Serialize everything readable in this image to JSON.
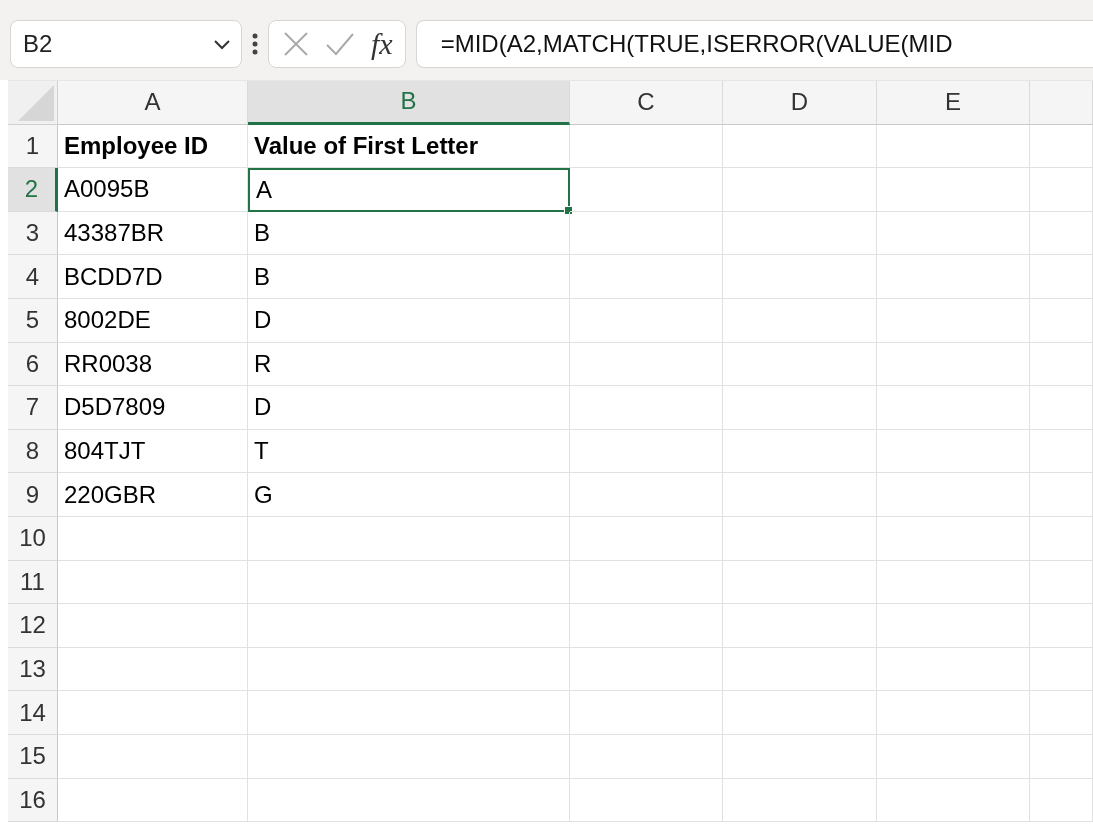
{
  "formula_bar": {
    "name_box": "B2",
    "function_button": "fx",
    "formula": "=MID(A2,MATCH(TRUE,ISERROR(VALUE(MID"
  },
  "columns": [
    {
      "label": "A",
      "selected": false
    },
    {
      "label": "B",
      "selected": true
    },
    {
      "label": "C",
      "selected": false
    },
    {
      "label": "D",
      "selected": false
    },
    {
      "label": "E",
      "selected": false
    }
  ],
  "rows": [
    {
      "number": "1",
      "selected": false,
      "bold": true,
      "cells": [
        {
          "text": "Employee ID",
          "selected": false
        },
        {
          "text": "Value of First Letter",
          "selected": false
        }
      ]
    },
    {
      "number": "2",
      "selected": true,
      "bold": false,
      "cells": [
        {
          "text": "A0095B",
          "selected": false
        },
        {
          "text": "A",
          "selected": true
        }
      ]
    },
    {
      "number": "3",
      "selected": false,
      "bold": false,
      "cells": [
        {
          "text": "43387BR",
          "selected": false
        },
        {
          "text": "B",
          "selected": false
        }
      ]
    },
    {
      "number": "4",
      "selected": false,
      "bold": false,
      "cells": [
        {
          "text": "BCDD7D",
          "selected": false
        },
        {
          "text": "B",
          "selected": false
        }
      ]
    },
    {
      "number": "5",
      "selected": false,
      "bold": false,
      "cells": [
        {
          "text": "8002DE",
          "selected": false
        },
        {
          "text": "D",
          "selected": false
        }
      ]
    },
    {
      "number": "6",
      "selected": false,
      "bold": false,
      "cells": [
        {
          "text": "RR0038",
          "selected": false
        },
        {
          "text": "R",
          "selected": false
        }
      ]
    },
    {
      "number": "7",
      "selected": false,
      "bold": false,
      "cells": [
        {
          "text": "D5D7809",
          "selected": false
        },
        {
          "text": "D",
          "selected": false
        }
      ]
    },
    {
      "number": "8",
      "selected": false,
      "bold": false,
      "cells": [
        {
          "text": "804TJT",
          "selected": false
        },
        {
          "text": "T",
          "selected": false
        }
      ]
    },
    {
      "number": "9",
      "selected": false,
      "bold": false,
      "cells": [
        {
          "text": "220GBR",
          "selected": false
        },
        {
          "text": "G",
          "selected": false
        }
      ]
    },
    {
      "number": "10",
      "selected": false
    },
    {
      "number": "11",
      "selected": false
    },
    {
      "number": "12",
      "selected": false
    },
    {
      "number": "13",
      "selected": false
    },
    {
      "number": "14",
      "selected": false
    },
    {
      "number": "15",
      "selected": false
    },
    {
      "number": "16",
      "selected": false
    }
  ]
}
